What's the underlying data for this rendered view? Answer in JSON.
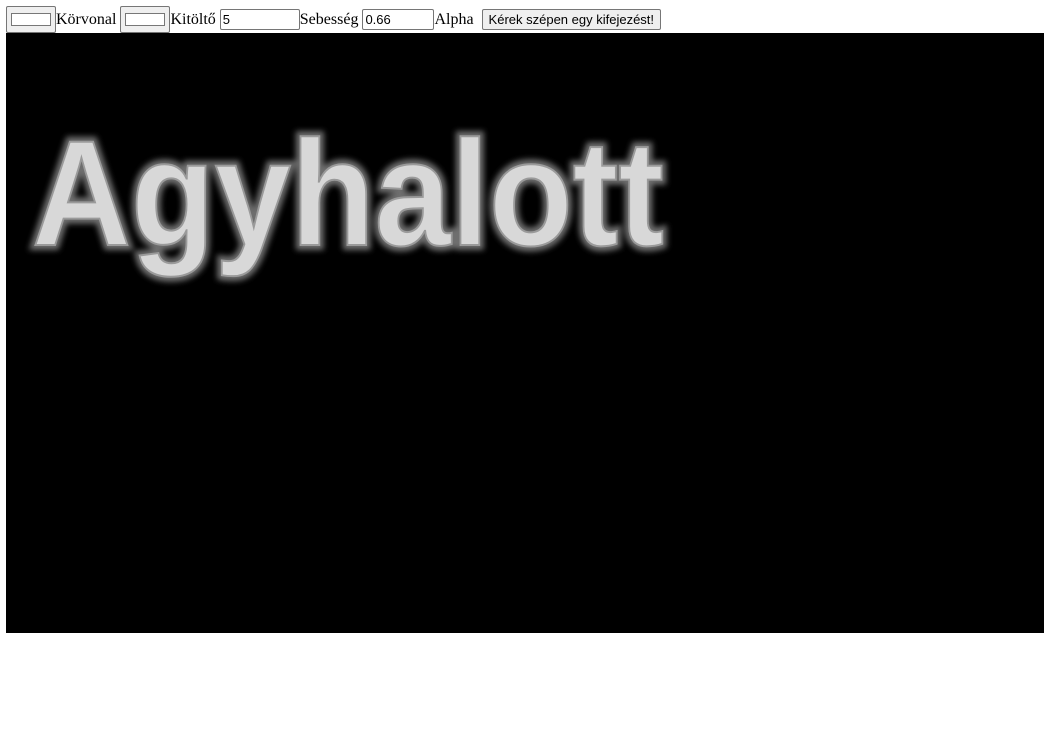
{
  "toolbar": {
    "stroke_color": {
      "label": "Körvonal",
      "value": "#ffffff"
    },
    "fill_color": {
      "label": "Kitöltő",
      "value": "#ffffff"
    },
    "speed": {
      "label": "Sebesség",
      "value": "5"
    },
    "alpha": {
      "label": "Alpha",
      "value": "0.66"
    },
    "action_button_label": "Kérek szépen egy kifejezést!"
  },
  "canvas": {
    "background": "#000000",
    "phrase": "Agyhalott",
    "text_fill_color": "#d8d8d8",
    "text_glow_color": "#6e6e6e"
  }
}
